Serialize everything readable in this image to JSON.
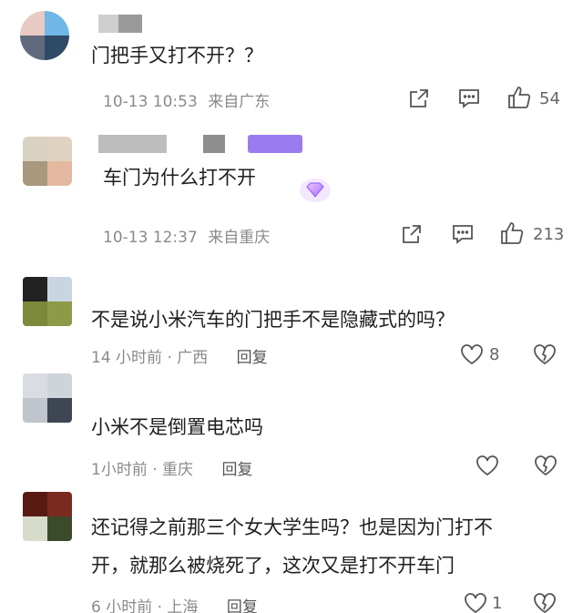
{
  "comments": [
    {
      "text": "门把手又打不开？？",
      "date": "10-13 10:53",
      "location": "来自广东",
      "likes": "54"
    },
    {
      "text": "车门为什么打不开",
      "date": "10-13 12:37",
      "location": "来自重庆",
      "likes": "213"
    },
    {
      "text": "不是说小米汽车的门把手不是隐藏式的吗？",
      "time": "14 小时前 · 广西",
      "reply": "回复",
      "likes": "8"
    },
    {
      "text": "小米不是倒置电芯吗",
      "time": "1小时前 · 重庆",
      "reply": "回复"
    },
    {
      "text_line1": "还记得之前那三个女大学生吗？也是因为门打不",
      "text_line2": "开，就那么被烧死了，这次又是打不开车门",
      "time": "6 小时前 · 上海",
      "reply": "回复",
      "likes": "1"
    }
  ],
  "colors": {
    "text": "#1f1f1f",
    "meta": "#8a8a8a",
    "icon": "#555555",
    "badge": "#8a5cf6"
  },
  "icons": [
    "share-icon",
    "comment-icon",
    "thumbs-up-icon",
    "heart-icon",
    "broken-heart-icon",
    "gem-badge-icon"
  ]
}
